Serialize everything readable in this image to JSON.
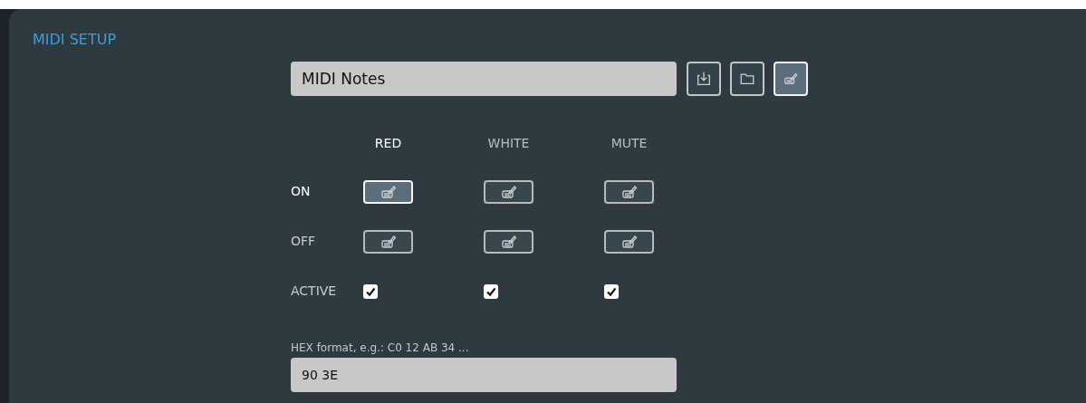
{
  "panel": {
    "title": "MIDI SETUP"
  },
  "preset": {
    "value": "MIDI Notes",
    "buttons": [
      {
        "kind": "save",
        "selected": false
      },
      {
        "kind": "open",
        "selected": false
      },
      {
        "kind": "edit",
        "selected": true
      }
    ]
  },
  "columns": [
    {
      "label": "RED",
      "selected": true
    },
    {
      "label": "WHITE",
      "selected": false
    },
    {
      "label": "MUTE",
      "selected": false
    }
  ],
  "rows": [
    {
      "label": "ON",
      "kind": "edit",
      "cells": [
        {
          "selected": true
        },
        {
          "selected": false
        },
        {
          "selected": false
        }
      ]
    },
    {
      "label": "OFF",
      "kind": "edit",
      "cells": [
        {
          "selected": false
        },
        {
          "selected": false
        },
        {
          "selected": false
        }
      ]
    },
    {
      "label": "ACTIVE",
      "kind": "check",
      "cells": [
        {
          "checked": true
        },
        {
          "checked": true
        },
        {
          "checked": true
        }
      ]
    }
  ],
  "hex": {
    "label": "HEX format, e.g.: C0 12 AB 34 ...",
    "value": "90 3E"
  }
}
